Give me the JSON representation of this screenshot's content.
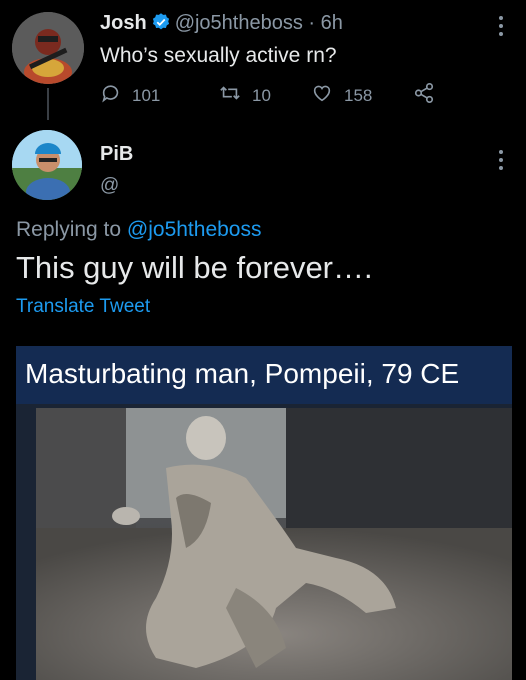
{
  "tweet": {
    "author_name": "Josh",
    "handle_time": "@jo5htheboss · 6h",
    "text": "Who’s sexually active rn?",
    "replies": "101",
    "retweets": "10",
    "likes": "158",
    "icons": [
      "avatar",
      "verified-icon",
      "more-icon",
      "reply-icon",
      "retweet-icon",
      "like-icon",
      "share-icon"
    ]
  },
  "reply": {
    "author_name": "PiB",
    "handle": "@",
    "replying_prefix": "Replying to",
    "replying_handle": "@jo5htheboss",
    "text": "This guy will be forever….",
    "translate_label": "Translate Tweet",
    "media_caption": "Masturbating man, Pompeii, 79 CE"
  },
  "colors": {
    "background": "#000000",
    "text": "#e7e9ea",
    "muted": "#8b98a5",
    "link": "#1d9bf0",
    "caption_bar": "#142b52"
  }
}
